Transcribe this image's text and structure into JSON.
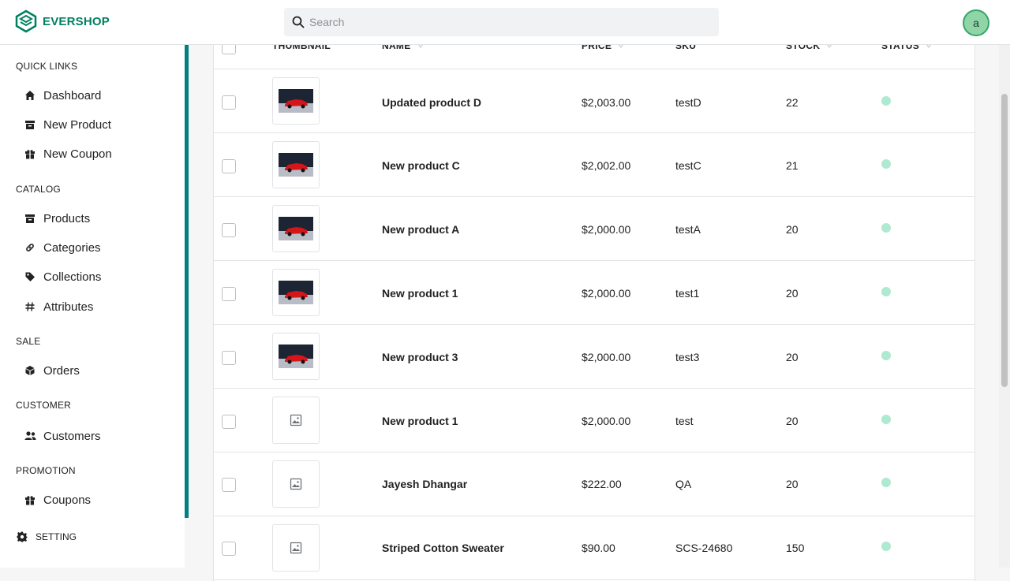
{
  "header": {
    "brand": "EVERSHOP",
    "search_placeholder": "Search",
    "avatar_initial": "a",
    "accent_color": "#008060"
  },
  "sidebar": {
    "sections": [
      {
        "title": "QUICK LINKS",
        "items": [
          {
            "label": "Dashboard",
            "icon": "home-icon"
          },
          {
            "label": "New Product",
            "icon": "archive-icon"
          },
          {
            "label": "New Coupon",
            "icon": "gift-icon"
          }
        ]
      },
      {
        "title": "CATALOG",
        "items": [
          {
            "label": "Products",
            "icon": "archive-icon"
          },
          {
            "label": "Categories",
            "icon": "link-icon"
          },
          {
            "label": "Collections",
            "icon": "tag-icon"
          },
          {
            "label": "Attributes",
            "icon": "hash-icon"
          }
        ]
      },
      {
        "title": "SALE",
        "items": [
          {
            "label": "Orders",
            "icon": "cube-icon"
          }
        ]
      },
      {
        "title": "CUSTOMER",
        "items": [
          {
            "label": "Customers",
            "icon": "users-icon"
          }
        ]
      },
      {
        "title": "PROMOTION",
        "items": [
          {
            "label": "Coupons",
            "icon": "gift-icon"
          }
        ]
      }
    ],
    "setting_label": "SETTING"
  },
  "table": {
    "columns": [
      "THUMBNAIL",
      "NAME",
      "PRICE",
      "SKU",
      "STOCK",
      "STATUS"
    ],
    "rows": [
      {
        "name": "Updated product D",
        "price": "$2,003.00",
        "sku": "testD",
        "stock": "22",
        "thumbnail": "car-image"
      },
      {
        "name": "New product C",
        "price": "$2,002.00",
        "sku": "testC",
        "stock": "21",
        "thumbnail": "car-image"
      },
      {
        "name": "New product A",
        "price": "$2,000.00",
        "sku": "testA",
        "stock": "20",
        "thumbnail": "car-image"
      },
      {
        "name": "New product 1",
        "price": "$2,000.00",
        "sku": "test1",
        "stock": "20",
        "thumbnail": "car-image"
      },
      {
        "name": "New product 3",
        "price": "$2,000.00",
        "sku": "test3",
        "stock": "20",
        "thumbnail": "car-image"
      },
      {
        "name": "New product 1",
        "price": "$2,000.00",
        "sku": "test",
        "stock": "20",
        "thumbnail": "placeholder-image-icon"
      },
      {
        "name": "Jayesh Dhangar",
        "price": "$222.00",
        "sku": "QA",
        "stock": "20",
        "thumbnail": "placeholder-image-icon"
      },
      {
        "name": "Striped Cotton Sweater",
        "price": "$90.00",
        "sku": "SCS-24680",
        "stock": "150",
        "thumbnail": "placeholder-image-icon"
      }
    ],
    "status_color": "#aee9d1"
  }
}
